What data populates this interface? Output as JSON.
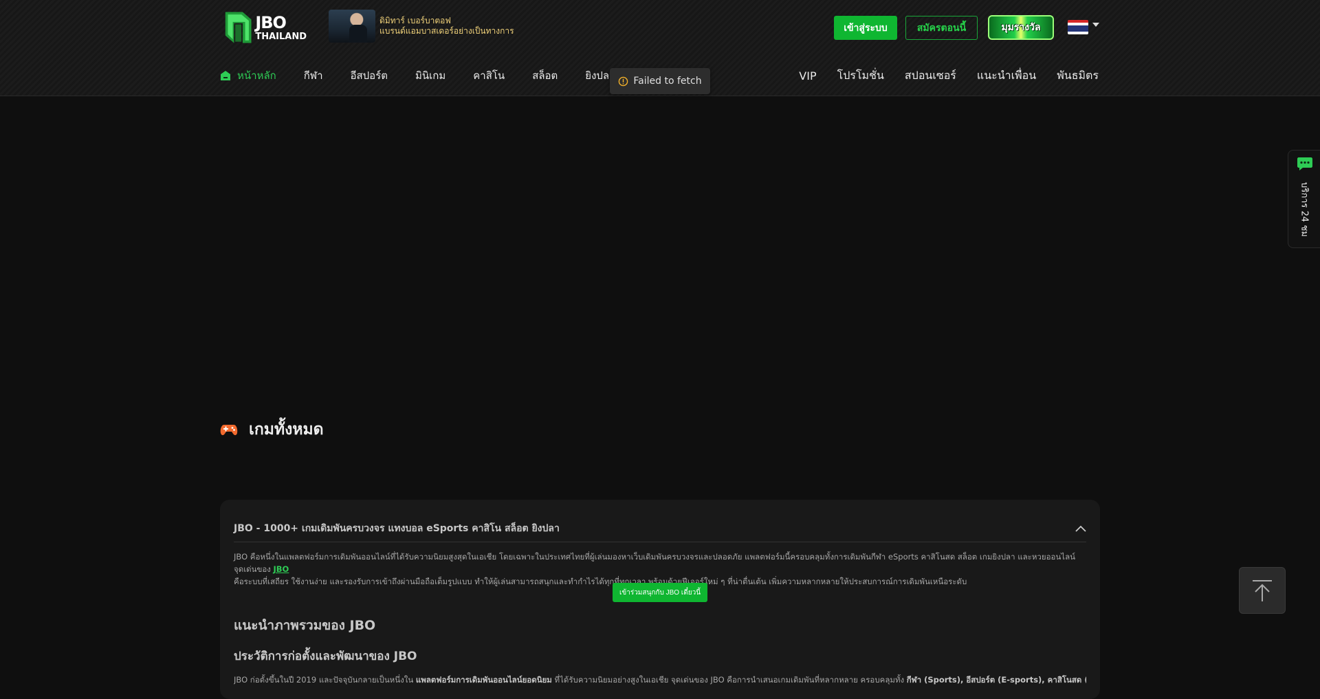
{
  "header": {
    "logo": {
      "line1": "JBO",
      "line2": "THAILAND"
    },
    "ambassador": {
      "line1": "ดิมิทาร์ เบอร์บาตอฟ",
      "line2": "แบรนด์แอมบาสเดอร์อย่างเป็นทางการ"
    },
    "login_label": "เข้าสู่ระบบ",
    "register_label": "สมัครตอนนี้",
    "reward_label": "มุมรางวัล",
    "flag_icon": "thailand-flag-icon",
    "colors": {
      "accent": "#0fb631",
      "accent_text": "#2ecc55",
      "gold": "#f1d27a"
    }
  },
  "nav": {
    "left": [
      {
        "label": "หน้าหลัก",
        "active": true,
        "icon": "home-icon"
      },
      {
        "label": "กีฬา"
      },
      {
        "label": "อีสปอร์ต"
      },
      {
        "label": "มินิเกม"
      },
      {
        "label": "คาสิโน"
      },
      {
        "label": "สล็อต"
      },
      {
        "label": "ยิงปลา"
      }
    ],
    "right": [
      {
        "label": "VIP"
      },
      {
        "label": "โปรโมชั่น"
      },
      {
        "label": "สปอนเซอร์"
      },
      {
        "label": "แนะนำเพื่อน"
      },
      {
        "label": "พันธมิตร"
      }
    ]
  },
  "toast": {
    "message": "Failed to fetch",
    "icon": "warning-icon"
  },
  "games_section": {
    "title": "เกมทั้งหมด",
    "icon": "gamepad-icon"
  },
  "info_panel": {
    "heading": "JBO - 1000+ เกมเดิมพันครบวงจร แทงบอล eSports คาสิโน สล็อต ยิงปลา",
    "para1_text": "JBO คือหนึ่งในแพลตฟอร์มการเดิมพันออนไลน์ที่ได้รับความนิยมสูงสุดในเอเชีย โดยเฉพาะในประเทศไทยที่ผู้เล่นมองหาเว็บเดิมพันครบวงจรและปลอดภัย แพลตฟอร์มนี้ครอบคลุมทั้งการเดิมพันกีฬา eSports คาสิโนสด สล็อต เกมยิงปลา และหวยออนไลน์ จุดเด่นของ ",
    "para1_link": "JBO",
    "para1_line2": "คือระบบที่เสถียร ใช้งานง่าย และรองรับการเข้าถึงผ่านมือถือเต็มรูปแบบ ทำให้ผู้เล่นสามารถสนุกและทำกำไรได้ทุกที่ทุกเวลา พร้อมด้วยฟีเจอร์ใหม่ ๆ ที่น่าตื่นเต้น เพิ่มความหลากหลายให้ประสบการณ์การเดิมพันเหนือระดับ",
    "join_label": "เข้าร่วมสนุกกับ JBO เดี๋ยวนี้",
    "h2": "แนะนำภาพรวมของ JBO",
    "h3": "ประวัติการก่อตั้งและพัฒนาของ JBO",
    "para2_text": "JBO ก่อตั้งขึ้นในปี 2019 และปัจจุบันกลายเป็นหนึ่งใน ",
    "para2_bold": "แพลตฟอร์มการเดิมพันออนไลน์ยอดนิยม",
    "para2_rest": " ที่ได้รับความนิยมอย่างสูงในเอเชีย จุดเด่นของ JBO คือการนำเสนอเกมเดิมพันที่หลากหลาย ครอบคลุมทั้ง ",
    "para2_b2": "กีฬา (Sports), อีสปอร์ต (E-sports), คาสิโนสด (Live"
  },
  "side_service": {
    "label": "บริการ 24 ชม",
    "icon": "chat-support-icon"
  },
  "back_to_top": {
    "icon": "arrow-up-icon"
  }
}
